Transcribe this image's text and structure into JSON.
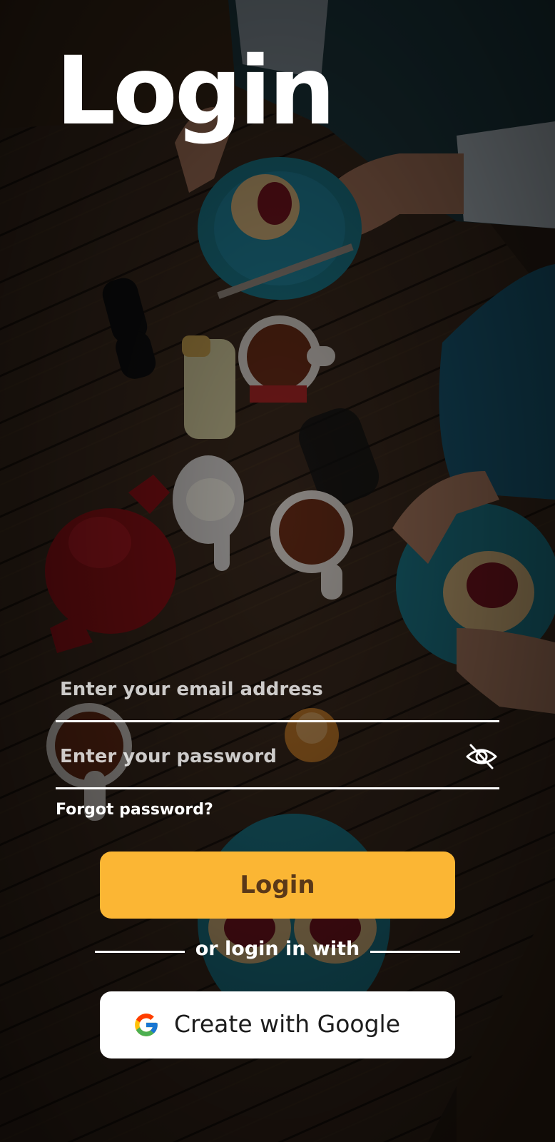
{
  "title": "Login",
  "email": {
    "placeholder": "Enter your email address",
    "value": ""
  },
  "password": {
    "placeholder": "Enter your password",
    "value": "",
    "toggle_icon": "eye-off-icon"
  },
  "forgot_password": "Forgot password?",
  "login_button": "Login",
  "divider_text": "or login in with",
  "google_button": {
    "label": "Create with Google",
    "icon": "google-icon"
  },
  "colors": {
    "accent": "#fbb634",
    "accent_text": "#5a3818",
    "text_light": "#ffffff"
  }
}
